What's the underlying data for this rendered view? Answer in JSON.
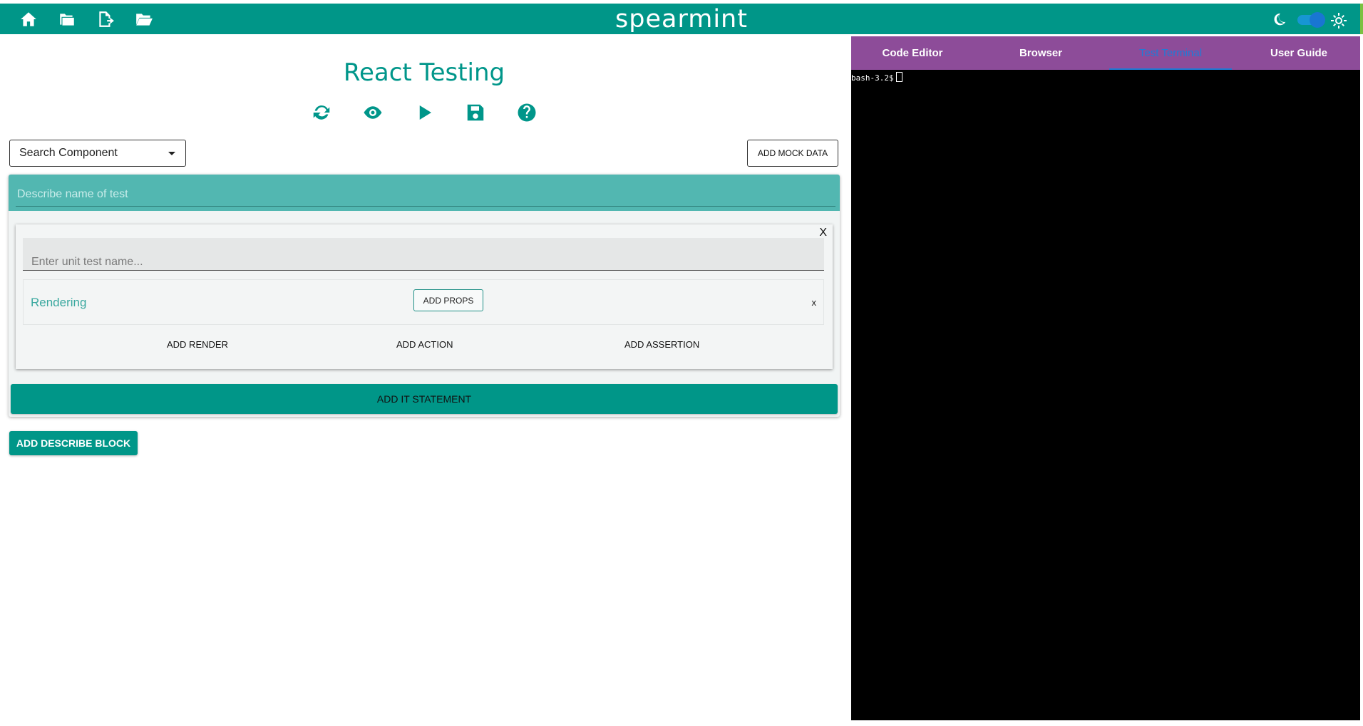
{
  "app": {
    "brand": "spearmint",
    "nav_icons": [
      "home-icon",
      "file-explorer-icon",
      "export-icon",
      "open-folder-icon"
    ],
    "theme": {
      "dark_icon": "moon-icon",
      "light_icon": "sun-icon",
      "toggle_color": "#2196f3"
    }
  },
  "colors": {
    "teal": "#009688",
    "purple": "#8d4c99",
    "active_tab": "#1f7bd6",
    "terminal_bg": "#000000"
  },
  "main": {
    "title": "React Testing",
    "toolbar_icons": [
      "refresh-icon",
      "preview-eye-icon",
      "run-play-icon",
      "save-icon",
      "help-icon"
    ],
    "component_select": {
      "value": "Search Component"
    },
    "mock_button_label": "ADD MOCK DATA",
    "describe": {
      "placeholder": "Describe name of test",
      "it_block": {
        "close_label": "X",
        "unit_placeholder": "Enter unit test name...",
        "rendering": {
          "label": "Rendering",
          "props_button": "ADD PROPS",
          "close_label": "x"
        },
        "actions": [
          "ADD RENDER",
          "ADD ACTION",
          "ADD ASSERTION"
        ]
      },
      "add_it_label": "ADD IT STATEMENT"
    },
    "add_describe_label": "ADD DESCRIBE BLOCK"
  },
  "right": {
    "tabs": [
      {
        "label": "Code Editor",
        "active": false
      },
      {
        "label": "Browser",
        "active": false
      },
      {
        "label": "Test Terminal",
        "active": true
      },
      {
        "label": "User Guide",
        "active": false
      }
    ],
    "terminal": {
      "prompt": "bash-3.2$"
    }
  }
}
